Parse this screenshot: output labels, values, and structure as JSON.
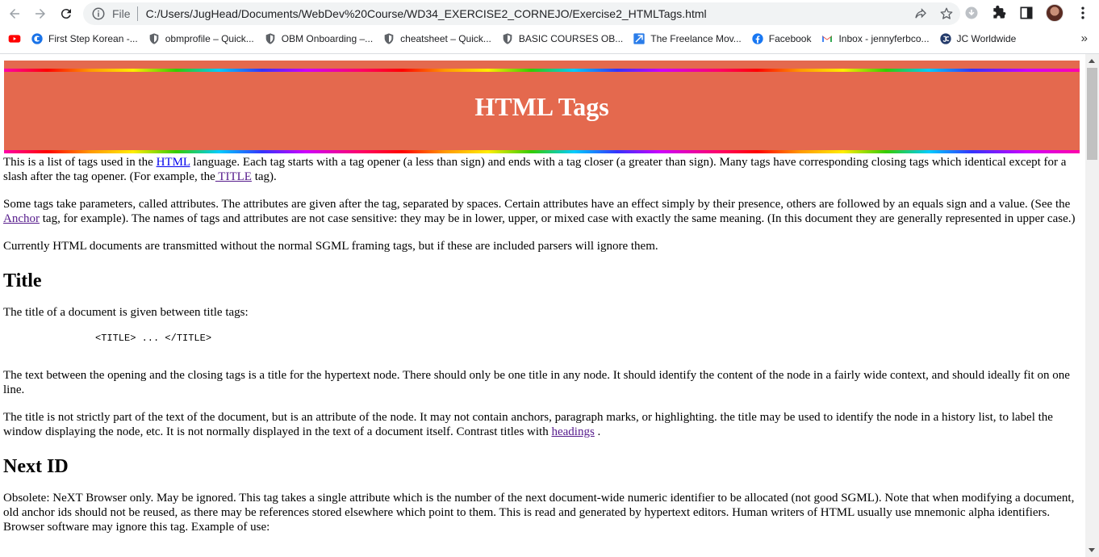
{
  "browser": {
    "omnibox": {
      "scheme_label": "File",
      "url": "C:/Users/JugHead/Documents/WebDev%20Course/WD34_EXERCISE2_CORNEJO/Exercise2_HTMLTags.html"
    },
    "bookmarks": [
      {
        "label": "",
        "icon": "youtube-icon"
      },
      {
        "label": "First Step Korean -...",
        "icon": "coursera-icon"
      },
      {
        "label": "obmprofile – Quick...",
        "icon": "shield-icon"
      },
      {
        "label": "OBM Onboarding –...",
        "icon": "shield-icon"
      },
      {
        "label": "cheatsheet – Quick...",
        "icon": "shield-icon"
      },
      {
        "label": "BASIC COURSES OB...",
        "icon": "shield-icon"
      },
      {
        "label": "The Freelance Mov...",
        "icon": "freelance-icon"
      },
      {
        "label": "Facebook",
        "icon": "facebook-icon"
      },
      {
        "label": "Inbox - jennyferbco...",
        "icon": "gmail-icon"
      },
      {
        "label": "JC Worldwide",
        "icon": "jc-icon"
      }
    ],
    "bookmarks_more": "»"
  },
  "page": {
    "title": "HTML Tags",
    "intro": {
      "p1_a": "This is a list of tags used in the ",
      "p1_link_html": "HTML",
      "p1_b": " language. Each tag starts with a tag opener (a less than sign) and ends with a tag closer (a greater than sign). Many tags have corresponding closing tags which identical except for a slash after the tag opener. (For example, the",
      "p1_link_title": " TITLE",
      "p1_c": " tag).",
      "p2_a": "Some tags take parameters, called attributes. The attributes are given after the tag, separated by spaces. Certain attributes have an effect simply by their presence, others are followed by an equals sign and a value. (See the ",
      "p2_link_anchor": "Anchor",
      "p2_b": " tag, for example). The names of tags and attributes are not case sensitive: they may be in lower, upper, or mixed case with exactly the same meaning. (In this document they are generally represented in upper case.)",
      "p3": "Currently HTML documents are transmitted without the normal SGML framing tags, but if these are included parsers will ignore them."
    },
    "title_section": {
      "heading": "Title",
      "p1": "The title of a document is given between title tags:",
      "example": "<TITLE> ... </TITLE>",
      "p2": "The text between the opening and the closing tags is a title for the hypertext node. There should only be one title in any node. It should identify the content of the node in a fairly wide context, and should ideally fit on one line.",
      "p3_a": "The title is not strictly part of the text of the document, but is an attribute of the node. It may not contain anchors, paragraph marks, or highlighting. the title may be used to identify the node in a history list, to label the window displaying the node, etc. It is not normally displayed in the text of a document itself. Contrast titles with ",
      "p3_link": "headings",
      "p3_b": " ."
    },
    "nextid_section": {
      "heading": "Next ID",
      "p1": "Obsolete: NeXT Browser only. May be ignored. This tag takes a single attribute which is the number of the next document-wide numeric identifier to be allocated (not good SGML). Note that when modifying a document, old anchor ids should not be reused, as there may be references stored elsewhere which point to them. This is read and generated by hypertext editors. Human writers of HTML usually use mnemonic alpha identifiers. Browser software may ignore this tag. Example of use:"
    }
  }
}
